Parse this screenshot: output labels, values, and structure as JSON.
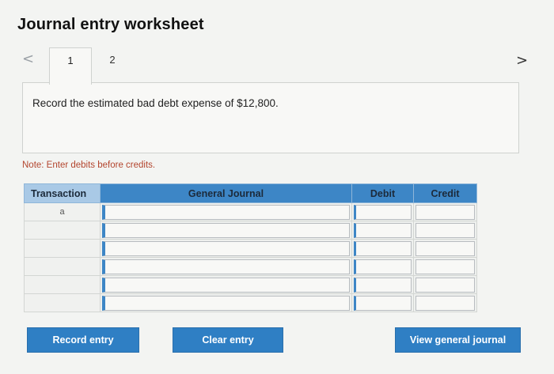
{
  "header": {
    "title": "Journal entry worksheet",
    "prev_glyph": "<",
    "next_glyph": ">"
  },
  "tabs": [
    {
      "label": "1",
      "active": true
    },
    {
      "label": "2",
      "active": false
    }
  ],
  "prompt": {
    "text": "Record the estimated bad debt expense of $12,800."
  },
  "note": "Note: Enter debits before credits.",
  "table": {
    "headers": [
      "Transaction",
      "General Journal",
      "Debit",
      "Credit"
    ],
    "rows": [
      {
        "transaction": "a",
        "general_journal": "",
        "debit": "",
        "credit": ""
      },
      {
        "transaction": "",
        "general_journal": "",
        "debit": "",
        "credit": ""
      },
      {
        "transaction": "",
        "general_journal": "",
        "debit": "",
        "credit": ""
      },
      {
        "transaction": "",
        "general_journal": "",
        "debit": "",
        "credit": ""
      },
      {
        "transaction": "",
        "general_journal": "",
        "debit": "",
        "credit": ""
      },
      {
        "transaction": "",
        "general_journal": "",
        "debit": "",
        "credit": ""
      }
    ]
  },
  "buttons": {
    "record": "Record entry",
    "clear": "Clear entry",
    "view": "View general journal"
  },
  "colors": {
    "accent": "#2f7fc4",
    "header_bg": "#3d86c6",
    "note": "#b3452e"
  }
}
